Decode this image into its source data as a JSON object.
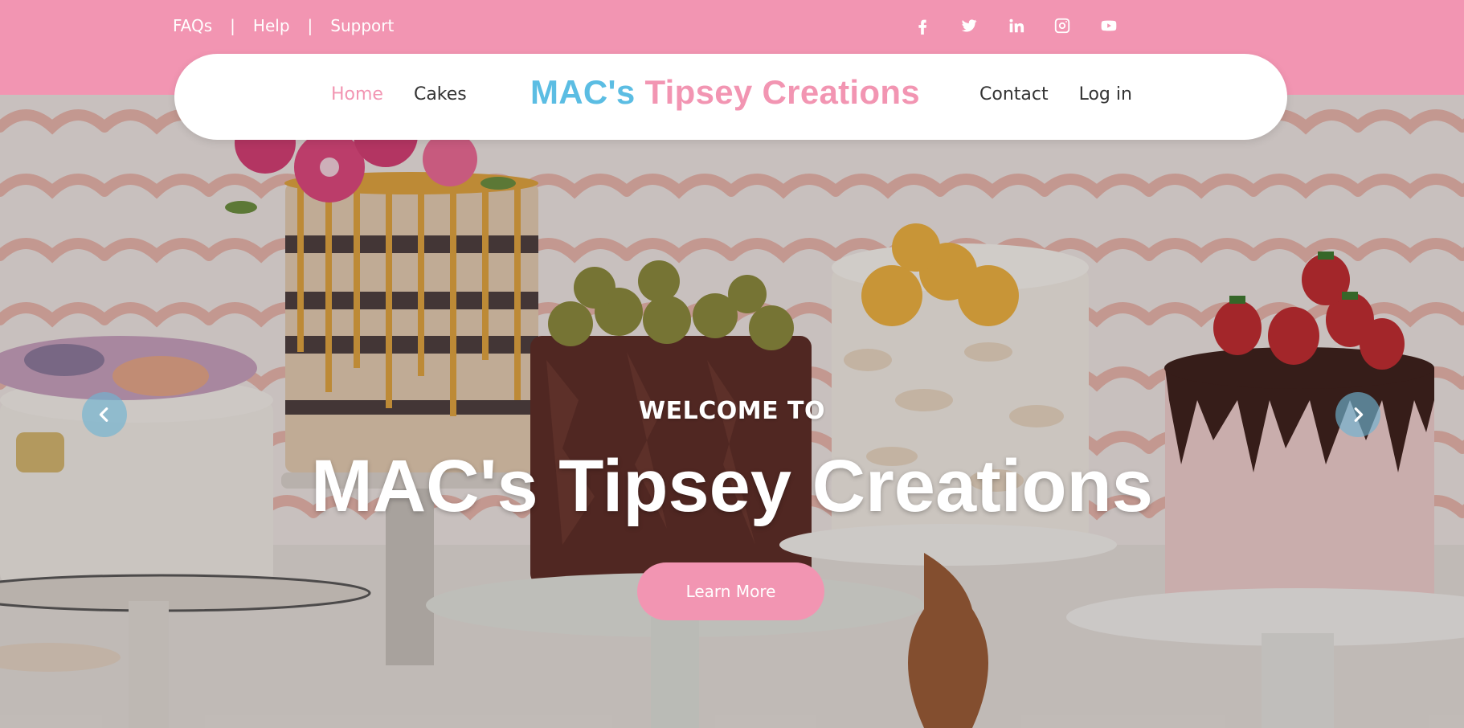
{
  "topbar": {
    "links": [
      "FAQs",
      "Help",
      "Support"
    ],
    "separator": "|",
    "socials": [
      "facebook-icon",
      "twitter-icon",
      "linkedin-icon",
      "instagram-icon",
      "youtube-icon"
    ]
  },
  "nav": {
    "left": [
      {
        "label": "Home",
        "active": true
      },
      {
        "label": "Cakes",
        "active": false
      }
    ],
    "brand": {
      "part1": "MAC's",
      "part2": "Tipsey Creations"
    },
    "right": [
      {
        "label": "Contact"
      },
      {
        "label": "Log in"
      }
    ]
  },
  "hero": {
    "welcome": "WELCOME TO",
    "title": "MAC's Tipsey Creations",
    "button": "Learn More",
    "prev_icon": "chevron-left-icon",
    "next_icon": "chevron-right-icon"
  },
  "colors": {
    "pink": "#f295b2",
    "blue": "#5bbde3",
    "white": "#ffffff",
    "text_dark": "#333333"
  }
}
